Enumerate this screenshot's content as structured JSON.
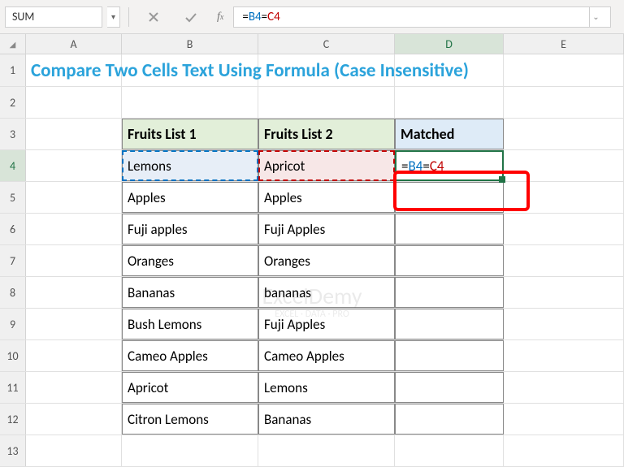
{
  "nameBox": "SUM",
  "formula_prefix": "=",
  "formula_ref1": "B4",
  "formula_mid": "=",
  "formula_ref2": "C4",
  "columns": [
    "A",
    "B",
    "C",
    "D",
    "E"
  ],
  "activeCol": "D",
  "activeRow": "4",
  "title": "Compare Two Cells Text Using Formula (Case Insensitive)",
  "headers": {
    "b": "Fruits List 1",
    "c": "Fruits List 2",
    "d": "Matched"
  },
  "rows": [
    {
      "n": "1"
    },
    {
      "n": "2"
    },
    {
      "n": "3"
    },
    {
      "n": "4"
    },
    {
      "n": "5"
    },
    {
      "n": "6"
    },
    {
      "n": "7"
    },
    {
      "n": "8"
    },
    {
      "n": "9"
    },
    {
      "n": "10"
    },
    {
      "n": "11"
    },
    {
      "n": "12"
    },
    {
      "n": "13"
    }
  ],
  "table": [
    {
      "b": "Lemons",
      "c": "Apricot"
    },
    {
      "b": "Apples",
      "c": "Apples"
    },
    {
      "b": "Fuji apples",
      "c": "Fuji Apples"
    },
    {
      "b": "Oranges",
      "c": "Oranges"
    },
    {
      "b": "Bananas",
      "c": "bananas"
    },
    {
      "b": "Bush Lemons",
      "c": "Fuji Apples"
    },
    {
      "b": "Cameo Apples",
      "c": "Cameo Apples"
    },
    {
      "b": "Apricot",
      "c": "Lemons"
    },
    {
      "b": "Citron Lemons",
      "c": "Bananas"
    }
  ],
  "watermark": {
    "main": "ExcelDemy",
    "sub": "EXCEL · DATA · PRO"
  }
}
